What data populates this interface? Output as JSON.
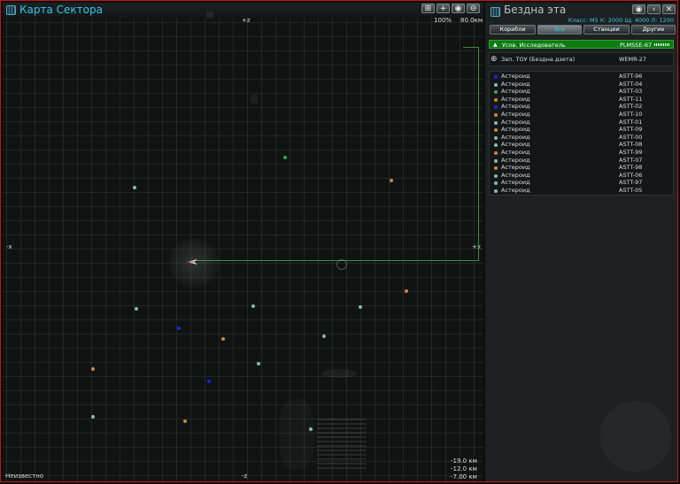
{
  "map": {
    "title": "Карта Сектора",
    "zoom": "100%",
    "range": "80.0км",
    "axis_top": "+z",
    "axis_bottom": "-z",
    "axis_left": "-x",
    "axis_right": "+x",
    "status": "Неизвестно",
    "coord_x": "-19.0 км",
    "coord_y": "-12.0 км",
    "coord_z": "-7.00 км",
    "toolbar": [
      "⊞",
      "+",
      "◉",
      "⊖"
    ]
  },
  "panel": {
    "title": "Бездна эта",
    "info": "Класс: M5  К: 2000  Щ: 4000  Л: 1200",
    "window_buttons": [
      "◉",
      "‹",
      "✕"
    ],
    "tabs": [
      "Корабли",
      "Все",
      "Станции",
      "Другие"
    ],
    "active_tab": "Все",
    "ship": {
      "name": "Усов. Исследователь",
      "code": "PLMSSE-67"
    },
    "gate": {
      "icon": "⊕",
      "name": "Зап. ТОУ (Бездна дзета)",
      "code": "WEMR-27"
    },
    "objects": [
      {
        "name": "Астероид",
        "code": "ASTT-96",
        "color": "#2222dd"
      },
      {
        "name": "Астероид",
        "code": "ASTT-04",
        "color": "#88bbaa"
      },
      {
        "name": "Астероид",
        "code": "ASTT-03",
        "color": "#33aa44"
      },
      {
        "name": "Астероид",
        "code": "ASTT-11",
        "color": "#cc8833"
      },
      {
        "name": "Астероид",
        "code": "ASTT-02",
        "color": "#2222dd"
      },
      {
        "name": "Астероид",
        "code": "ASTT-10",
        "color": "#cc8833"
      },
      {
        "name": "Астероид",
        "code": "ASTT-01",
        "color": "#88bbaa"
      },
      {
        "name": "Астероид",
        "code": "ASTT-09",
        "color": "#cc8833"
      },
      {
        "name": "Астероид",
        "code": "ASTT-00",
        "color": "#88bbaa"
      },
      {
        "name": "Астероид",
        "code": "ASTT-08",
        "color": "#88bbaa"
      },
      {
        "name": "Астероид",
        "code": "ASTT-99",
        "color": "#cc8833"
      },
      {
        "name": "Астероид",
        "code": "ASTT-07",
        "color": "#88bbaa"
      },
      {
        "name": "Астероид",
        "code": "ASTT-98",
        "color": "#cc8833"
      },
      {
        "name": "Астероид",
        "code": "ASTT-06",
        "color": "#88bbaa"
      },
      {
        "name": "Астероид",
        "code": "ASTT-97",
        "color": "#88bbaa"
      },
      {
        "name": "Астероид",
        "code": "ASTT-05",
        "color": "#88bbaa"
      }
    ]
  }
}
